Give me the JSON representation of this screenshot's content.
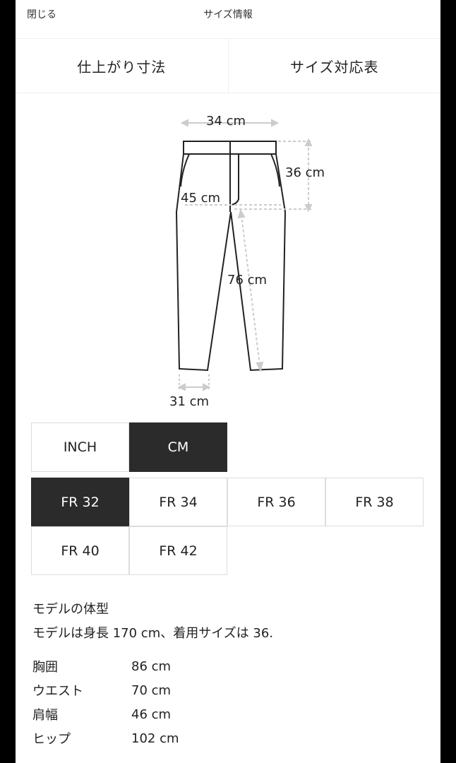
{
  "header": {
    "close_label": "閉じる",
    "title": "サイズ情報"
  },
  "tabs": [
    {
      "label": "仕上がり寸法"
    },
    {
      "label": "サイズ対応表"
    }
  ],
  "diagram": {
    "waist": "34 cm",
    "rise": "36 cm",
    "thigh": "45 cm",
    "inseam": "76 cm",
    "hem": "31 cm"
  },
  "units": [
    {
      "label": "INCH",
      "active": false
    },
    {
      "label": "CM",
      "active": true
    }
  ],
  "sizes": [
    {
      "label": "FR 32",
      "active": true
    },
    {
      "label": "FR 34",
      "active": false
    },
    {
      "label": "FR 36",
      "active": false
    },
    {
      "label": "FR 38",
      "active": false
    },
    {
      "label": "FR 40",
      "active": false
    },
    {
      "label": "FR 42",
      "active": false
    }
  ],
  "model": {
    "heading": "モデルの体型",
    "description": "モデルは身長 170 cm、着用サイズは 36."
  },
  "measurements": [
    {
      "label": "胸囲",
      "value": "86 cm"
    },
    {
      "label": "ウエスト",
      "value": "70 cm"
    },
    {
      "label": "肩幅",
      "value": "46 cm"
    },
    {
      "label": "ヒップ",
      "value": "102 cm"
    }
  ],
  "icons": {
    "pants": "pants-icon"
  },
  "colors": {
    "active_bg": "#2b2b2b",
    "active_fg": "#ffffff",
    "border": "#dddddd",
    "frame": "#000000"
  }
}
